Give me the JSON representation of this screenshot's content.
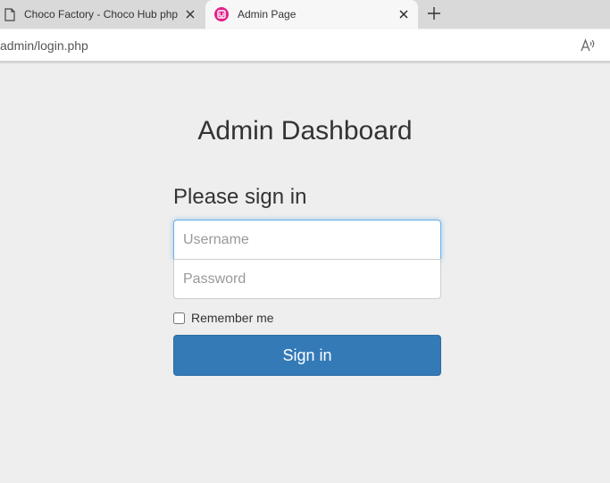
{
  "browser": {
    "tabs": [
      {
        "title": "Choco Factory - Choco Hub php",
        "icon": "page-icon"
      },
      {
        "title": "Admin Page",
        "icon": "site-favicon-icon",
        "active": true
      }
    ],
    "address_bar": {
      "url": "admin/login.php"
    }
  },
  "page": {
    "title": "Admin Dashboard",
    "form": {
      "heading": "Please sign in",
      "username_placeholder": "Username",
      "password_placeholder": "Password",
      "remember_label": "Remember me",
      "remember_checked": false,
      "submit_label": "Sign in"
    }
  },
  "colors": {
    "primary_button": "#337ab7",
    "focus_border": "#66afe9",
    "page_background": "#eeeeee",
    "favicon": "#e0218a"
  }
}
